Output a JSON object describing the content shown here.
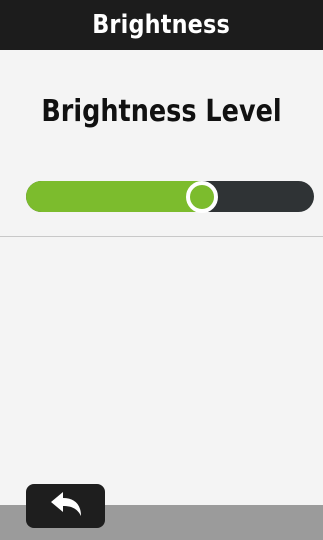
{
  "header": {
    "title": "Brightness"
  },
  "main": {
    "heading": "Brightness Level"
  },
  "brightness_slider": {
    "level": 0.61
  },
  "icons": {
    "back": "back-arrow-icon"
  },
  "colors": {
    "header_bg": "#1c1c1c",
    "slider_fill": "#7cbc2d",
    "slider_track": "#2f3335",
    "bottom_bar": "#9b9b9b"
  }
}
